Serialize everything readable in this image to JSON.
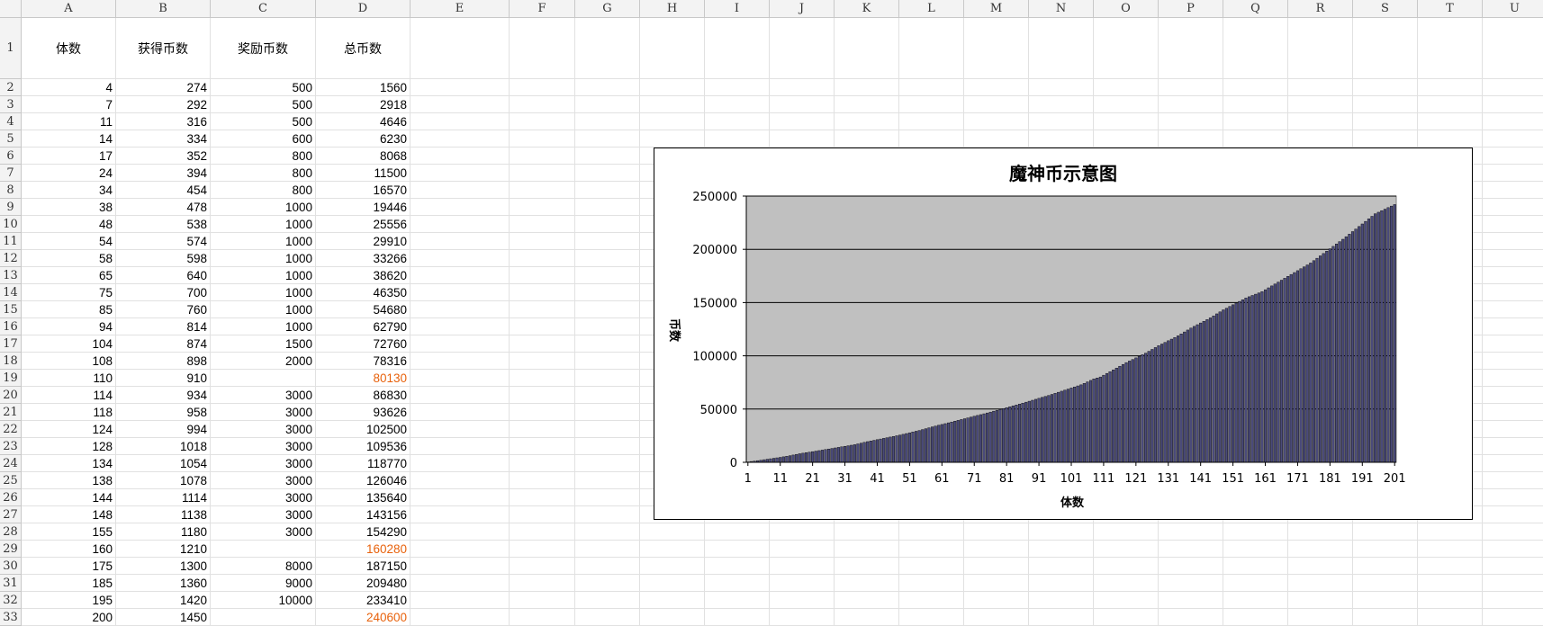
{
  "columns": [
    "A",
    "B",
    "C",
    "D",
    "E",
    "F",
    "G",
    "H",
    "I",
    "J",
    "K",
    "L",
    "M",
    "N",
    "O",
    "P",
    "Q",
    "R",
    "S",
    "T",
    "U"
  ],
  "rows": [
    {
      "r": "1",
      "a": "体数",
      "b": "获得币数",
      "c": "奖励币数",
      "d": "总币数"
    },
    {
      "r": "2",
      "a": "4",
      "b": "274",
      "c": "500",
      "d": "1560"
    },
    {
      "r": "3",
      "a": "7",
      "b": "292",
      "c": "500",
      "d": "2918"
    },
    {
      "r": "4",
      "a": "11",
      "b": "316",
      "c": "500",
      "d": "4646"
    },
    {
      "r": "5",
      "a": "14",
      "b": "334",
      "c": "600",
      "d": "6230"
    },
    {
      "r": "6",
      "a": "17",
      "b": "352",
      "c": "800",
      "d": "8068"
    },
    {
      "r": "7",
      "a": "24",
      "b": "394",
      "c": "800",
      "d": "11500"
    },
    {
      "r": "8",
      "a": "34",
      "b": "454",
      "c": "800",
      "d": "16570"
    },
    {
      "r": "9",
      "a": "38",
      "b": "478",
      "c": "1000",
      "d": "19446"
    },
    {
      "r": "10",
      "a": "48",
      "b": "538",
      "c": "1000",
      "d": "25556"
    },
    {
      "r": "11",
      "a": "54",
      "b": "574",
      "c": "1000",
      "d": "29910"
    },
    {
      "r": "12",
      "a": "58",
      "b": "598",
      "c": "1000",
      "d": "33266"
    },
    {
      "r": "13",
      "a": "65",
      "b": "640",
      "c": "1000",
      "d": "38620"
    },
    {
      "r": "14",
      "a": "75",
      "b": "700",
      "c": "1000",
      "d": "46350"
    },
    {
      "r": "15",
      "a": "85",
      "b": "760",
      "c": "1000",
      "d": "54680"
    },
    {
      "r": "16",
      "a": "94",
      "b": "814",
      "c": "1000",
      "d": "62790"
    },
    {
      "r": "17",
      "a": "104",
      "b": "874",
      "c": "1500",
      "d": "72760"
    },
    {
      "r": "18",
      "a": "108",
      "b": "898",
      "c": "2000",
      "d": "78316"
    },
    {
      "r": "19",
      "a": "110",
      "b": "910",
      "c": "",
      "d": "80130",
      "d_orange": true
    },
    {
      "r": "20",
      "a": "114",
      "b": "934",
      "c": "3000",
      "d": "86830"
    },
    {
      "r": "21",
      "a": "118",
      "b": "958",
      "c": "3000",
      "d": "93626"
    },
    {
      "r": "22",
      "a": "124",
      "b": "994",
      "c": "3000",
      "d": "102500"
    },
    {
      "r": "23",
      "a": "128",
      "b": "1018",
      "c": "3000",
      "d": "109536"
    },
    {
      "r": "24",
      "a": "134",
      "b": "1054",
      "c": "3000",
      "d": "118770"
    },
    {
      "r": "25",
      "a": "138",
      "b": "1078",
      "c": "3000",
      "d": "126046"
    },
    {
      "r": "26",
      "a": "144",
      "b": "1114",
      "c": "3000",
      "d": "135640"
    },
    {
      "r": "27",
      "a": "148",
      "b": "1138",
      "c": "3000",
      "d": "143156"
    },
    {
      "r": "28",
      "a": "155",
      "b": "1180",
      "c": "3000",
      "d": "154290"
    },
    {
      "r": "29",
      "a": "160",
      "b": "1210",
      "c": "",
      "d": "160280",
      "d_orange": true
    },
    {
      "r": "30",
      "a": "175",
      "b": "1300",
      "c": "8000",
      "d": "187150"
    },
    {
      "r": "31",
      "a": "185",
      "b": "1360",
      "c": "9000",
      "d": "209480"
    },
    {
      "r": "32",
      "a": "195",
      "b": "1420",
      "c": "10000",
      "d": "233410"
    },
    {
      "r": "33",
      "a": "200",
      "b": "1450",
      "c": "",
      "d": "240600",
      "d_orange": true
    }
  ],
  "colors": {
    "orange": "#e8620c",
    "plot_bg": "#c0c0c0",
    "bar_fill": "#4a4a7a",
    "bar_edge": "#000000"
  },
  "chart_data": {
    "type": "bar",
    "title": "魔神币示意图",
    "xlabel": "体数",
    "ylabel": "币数",
    "ylim": [
      0,
      250000
    ],
    "yticks": [
      0,
      50000,
      100000,
      150000,
      200000,
      250000
    ],
    "xtick_labels": [
      "1",
      "11",
      "21",
      "31",
      "41",
      "51",
      "61",
      "71",
      "81",
      "91",
      "101",
      "111",
      "121",
      "131",
      "141",
      "151",
      "161",
      "171",
      "181",
      "191",
      "201"
    ],
    "bar_count": 201,
    "grid": true,
    "legend": "none",
    "anchor_points": {
      "x": [
        4,
        7,
        11,
        14,
        17,
        24,
        34,
        38,
        48,
        54,
        58,
        65,
        75,
        85,
        94,
        104,
        108,
        110,
        114,
        118,
        124,
        128,
        134,
        138,
        144,
        148,
        155,
        160,
        175,
        185,
        195,
        200
      ],
      "y": [
        1560,
        2918,
        4646,
        6230,
        8068,
        11500,
        16570,
        19446,
        25556,
        29910,
        33266,
        38620,
        46350,
        54680,
        62790,
        72760,
        78316,
        80130,
        86830,
        93626,
        102500,
        109536,
        118770,
        126046,
        135640,
        143156,
        154290,
        160280,
        187150,
        209480,
        233410,
        240600
      ]
    }
  }
}
